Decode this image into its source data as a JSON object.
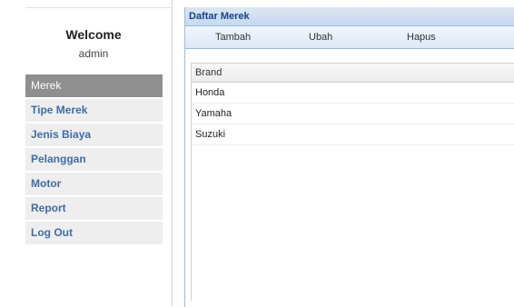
{
  "sidebar": {
    "welcome": "Welcome",
    "user": "admin",
    "items": [
      {
        "label": "Merek"
      },
      {
        "label": "Tipe Merek"
      },
      {
        "label": "Jenis Biaya"
      },
      {
        "label": "Pelanggan"
      },
      {
        "label": "Motor"
      },
      {
        "label": "Report"
      },
      {
        "label": "Log Out"
      }
    ]
  },
  "panel": {
    "title": "Daftar Merek",
    "toolbar": {
      "add_label": "Tambah",
      "edit_label": "Ubah",
      "delete_label": "Hapus"
    },
    "grid": {
      "column_header": "Brand",
      "rows": [
        "Honda",
        "Yamaha",
        "Suzuki"
      ]
    }
  }
}
